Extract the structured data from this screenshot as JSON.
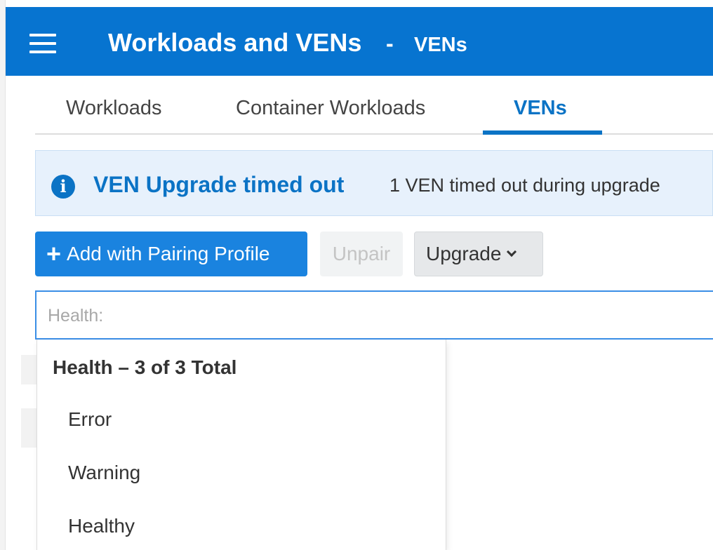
{
  "header": {
    "title": "Workloads and VENs",
    "separator": "-",
    "subtitle": "VENs"
  },
  "tabs": [
    {
      "label": "Workloads",
      "active": false
    },
    {
      "label": "Container Workloads",
      "active": false
    },
    {
      "label": "VENs",
      "active": true
    }
  ],
  "banner": {
    "title": "VEN Upgrade timed out",
    "message": "1 VEN timed out during upgrade",
    "icon": "info-icon"
  },
  "toolbar": {
    "add_icon": "+",
    "add_label": "Add with Pairing Profile",
    "unpair_label": "Unpair",
    "upgrade_label": "Upgrade"
  },
  "filter": {
    "placeholder": "Health:"
  },
  "dropdown": {
    "header": "Health – 3 of 3 Total",
    "items": [
      "Error",
      "Warning",
      "Healthy"
    ]
  },
  "colors": {
    "header_bg": "#0774d0",
    "accent": "#0b73c5",
    "primary_button": "#1a83df",
    "banner_bg": "#e7f1fc"
  }
}
